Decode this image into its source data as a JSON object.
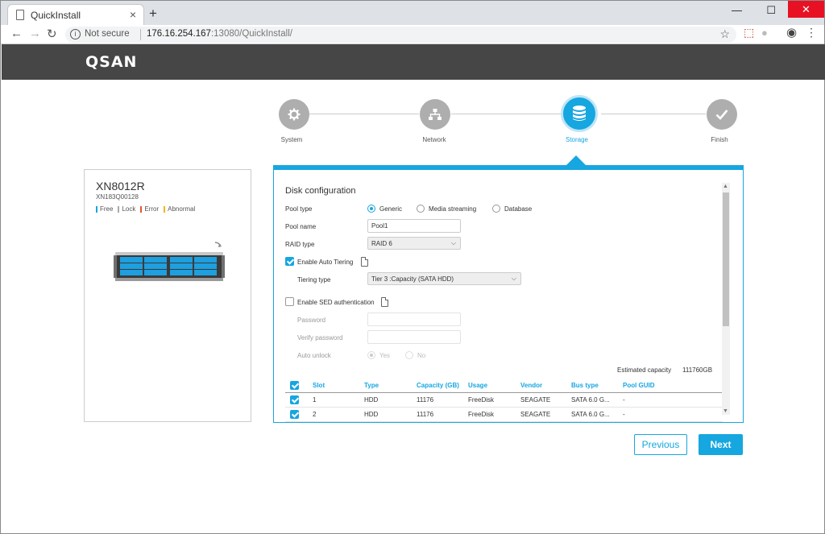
{
  "browser": {
    "tab_title": "QuickInstall",
    "new_tab": "+",
    "close_tab": "×",
    "security": "Not secure",
    "url_host": "176.16.254.167",
    "url_path": ":13080/QuickInstall/",
    "win_min": "—",
    "win_max": "☐",
    "win_close": "✕"
  },
  "header": {
    "logo": "QSAN"
  },
  "steps": [
    {
      "label": "System",
      "icon": "gear-icon",
      "active": false
    },
    {
      "label": "Network",
      "icon": "network-icon",
      "active": false
    },
    {
      "label": "Storage",
      "icon": "database-icon",
      "active": true
    },
    {
      "label": "Finish",
      "icon": "check-icon",
      "active": false
    }
  ],
  "device": {
    "model": "XN8012R",
    "serial": "XN183Q00128",
    "legend": [
      {
        "label": "Free",
        "color": "#16a6e0"
      },
      {
        "label": "Lock",
        "color": "#aaaaaa"
      },
      {
        "label": "Error",
        "color": "#e8562e"
      },
      {
        "label": "Abnormal",
        "color": "#f5b400"
      }
    ]
  },
  "disk_config": {
    "title": "Disk configuration",
    "pool_type_label": "Pool type",
    "pool_type_options": [
      "Generic",
      "Media streaming",
      "Database"
    ],
    "pool_type_selected": "Generic",
    "pool_name_label": "Pool name",
    "pool_name_value": "Pool1",
    "raid_type_label": "RAID type",
    "raid_type_value": "RAID 6",
    "auto_tiering_label": "Enable Auto Tiering",
    "auto_tiering_checked": true,
    "tiering_type_label": "Tiering type",
    "tiering_type_value": "Tier 3 :Capacity (SATA HDD)",
    "sed_label": "Enable SED authentication",
    "sed_checked": false,
    "password_label": "Password",
    "verify_password_label": "Verify password",
    "auto_unlock_label": "Auto unlock",
    "auto_unlock_yes": "Yes",
    "auto_unlock_no": "No",
    "estimated_capacity_label": "Estimated capacity",
    "estimated_capacity_value": "111760GB"
  },
  "disk_table": {
    "columns": [
      "Slot",
      "Type",
      "Capacity (GB)",
      "Usage",
      "Vendor",
      "Bus type",
      "Pool GUID"
    ],
    "rows": [
      {
        "slot": "1",
        "type": "HDD",
        "capacity": "11176",
        "usage": "FreeDisk",
        "vendor": "SEAGATE",
        "bus": "SATA 6.0 G...",
        "guid": "-"
      },
      {
        "slot": "2",
        "type": "HDD",
        "capacity": "11176",
        "usage": "FreeDisk",
        "vendor": "SEAGATE",
        "bus": "SATA 6.0 G...",
        "guid": "-"
      }
    ]
  },
  "buttons": {
    "previous": "Previous",
    "next": "Next"
  }
}
